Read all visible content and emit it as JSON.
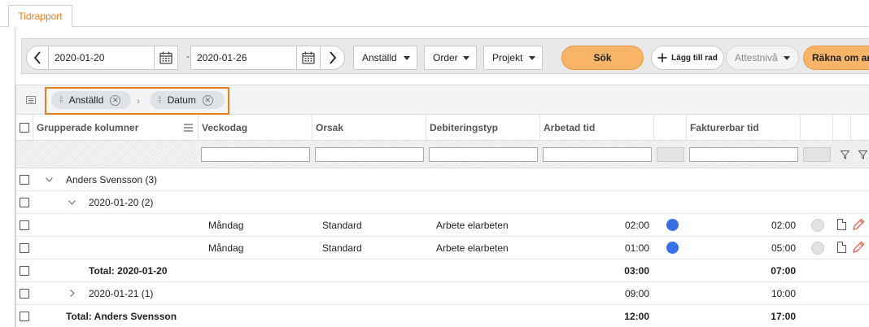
{
  "tabs": [
    {
      "label": "Tidrapport"
    }
  ],
  "toolbar": {
    "date_from": "2020-01-20",
    "date_sep": "-",
    "date_to": "2020-01-26",
    "filter_employee": "Anställd",
    "filter_order": "Order",
    "filter_project": "Projekt",
    "search_label": "Sök",
    "add_row_label": "Lägg till rad",
    "attest_label": "Attestnivå",
    "calc_label": "Räkna om arbe"
  },
  "grouping": {
    "chips": [
      {
        "label": "Anställd"
      },
      {
        "label": "Datum"
      }
    ]
  },
  "columns": {
    "grouped": "Grupperade kolumner",
    "weekday": "Veckodag",
    "reason": "Orsak",
    "debit_type": "Debiteringstyp",
    "worked_time": "Arbetad tid",
    "billable_time": "Fakturerbar tid"
  },
  "rows": {
    "group1": {
      "label": "Anders Svensson (3)"
    },
    "sub1": {
      "label": "2020-01-20 (2)"
    },
    "r1": {
      "weekday": "Måndag",
      "reason": "Standard",
      "debit": "Arbete elarbeten",
      "worked": "02:00",
      "billable": "02:00"
    },
    "r2": {
      "weekday": "Måndag",
      "reason": "Standard",
      "debit": "Arbete elarbeten",
      "worked": "01:00",
      "billable": "05:00"
    },
    "total_sub1": {
      "label": "Total: 2020-01-20",
      "worked": "03:00",
      "billable": "07:00"
    },
    "sub2": {
      "label": "2020-01-21 (1)",
      "worked": "09:00",
      "billable": "10:00"
    },
    "total_group1": {
      "label": "Total: Anders Svensson",
      "worked": "12:00",
      "billable": "17:00"
    }
  },
  "colors": {
    "accent": "#e87e1e",
    "button_orange": "#f9b567",
    "status_blue": "#3a6fe8"
  }
}
